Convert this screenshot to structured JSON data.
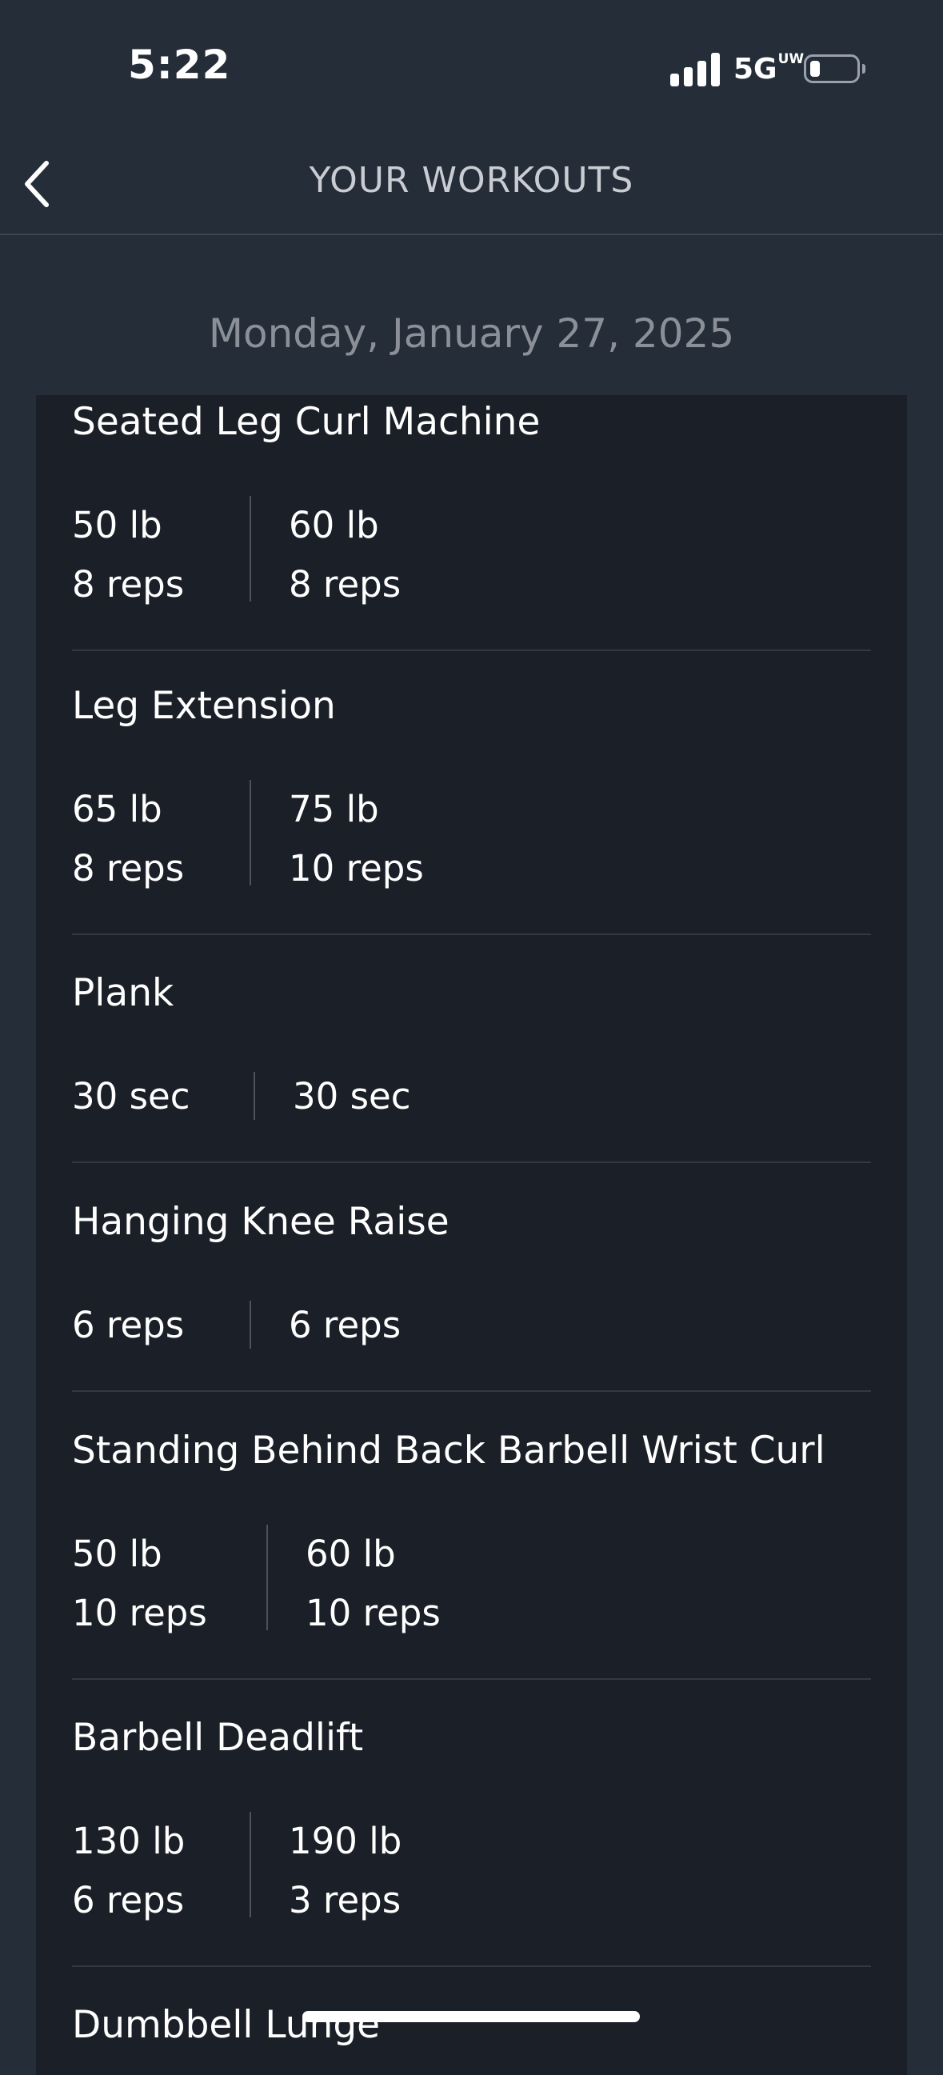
{
  "status_bar": {
    "time": "5:22",
    "network": "5G",
    "network_suffix": "UW",
    "icons": [
      "signal-icon",
      "battery-icon"
    ]
  },
  "nav": {
    "back_icon": "chevron-left-icon",
    "title": "YOUR WORKOUTS"
  },
  "date": "Monday, January 27, 2025",
  "exercises": [
    {
      "name": "Seated Leg Curl Machine",
      "sets": [
        {
          "weight": "50 lb",
          "reps": "8 reps"
        },
        {
          "weight": "60 lb",
          "reps": "8 reps"
        }
      ]
    },
    {
      "name": "Leg Extension",
      "sets": [
        {
          "weight": "65 lb",
          "reps": "8 reps"
        },
        {
          "weight": "75 lb",
          "reps": "10 reps"
        }
      ]
    },
    {
      "name": "Plank",
      "sets": [
        {
          "duration": "30 sec"
        },
        {
          "duration": "30 sec"
        }
      ]
    },
    {
      "name": "Hanging Knee Raise",
      "sets": [
        {
          "reps": "6 reps"
        },
        {
          "reps": "6 reps"
        }
      ]
    },
    {
      "name": "Standing Behind Back Barbell Wrist Curl",
      "sets": [
        {
          "weight": "50 lb",
          "reps": "10 reps"
        },
        {
          "weight": "60 lb",
          "reps": "10 reps"
        }
      ]
    },
    {
      "name": "Barbell Deadlift",
      "sets": [
        {
          "weight": "130 lb",
          "reps": "6 reps"
        },
        {
          "weight": "190 lb",
          "reps": "3 reps"
        }
      ]
    },
    {
      "name": "Dumbbell Lunge",
      "sets": []
    }
  ],
  "colors": {
    "background": "#252d38",
    "card": "#1b1f27",
    "date_text": "#8b9098",
    "nav_title": "#c9cdd3"
  }
}
